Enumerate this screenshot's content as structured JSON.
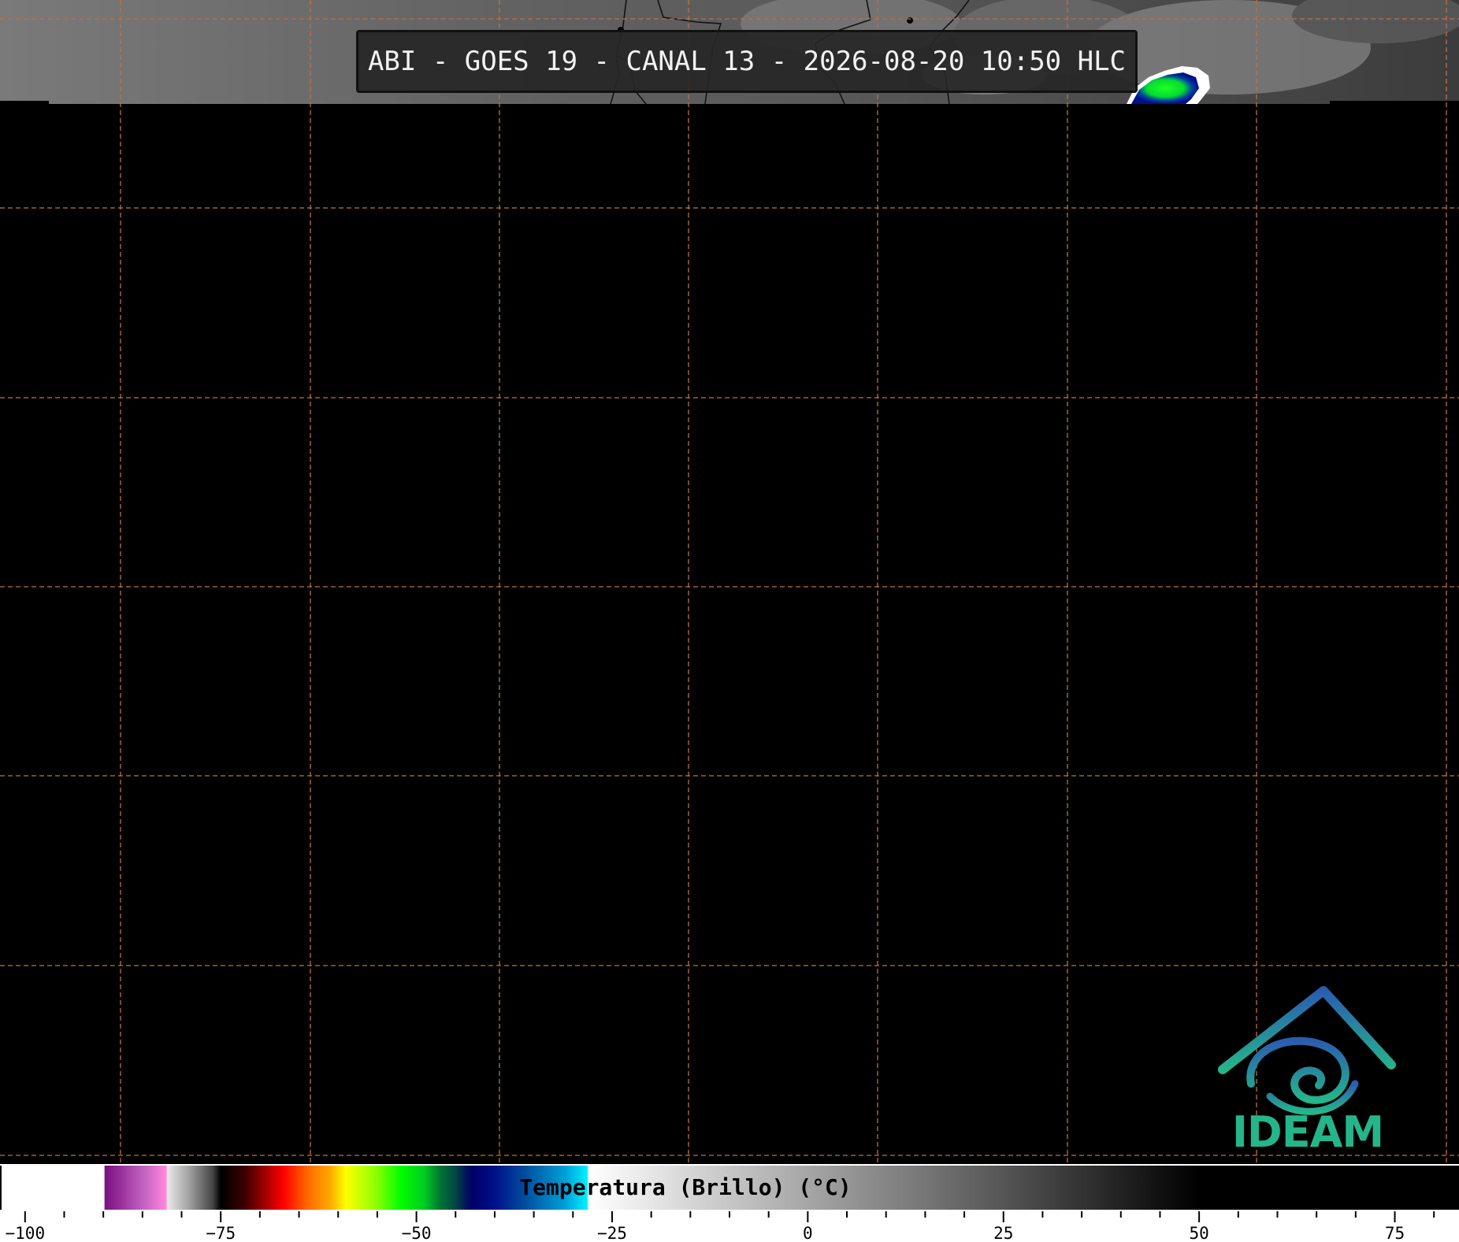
{
  "header": {
    "title": "ABI - GOES 19 - CANAL 13 - 2026-08-20 10:50 HLC"
  },
  "colorbar": {
    "label": "Temperatura (Brillo) (°C)",
    "range": [
      -103,
      83
    ],
    "ticks": [
      {
        "value": -100,
        "label": "−100"
      },
      {
        "value": -75,
        "label": "−75"
      },
      {
        "value": -50,
        "label": "−50"
      },
      {
        "value": -25,
        "label": "−25"
      },
      {
        "value": 0,
        "label": "0"
      },
      {
        "value": 25,
        "label": "25"
      },
      {
        "value": 50,
        "label": "50"
      },
      {
        "value": 75,
        "label": "75"
      }
    ],
    "minor_tick_step": 5,
    "stops": [
      {
        "value": -103,
        "color": "#ffffff"
      },
      {
        "value": -89.9,
        "color": "#ffffff"
      },
      {
        "value": -89.8,
        "color": "#7a0f80"
      },
      {
        "value": -85,
        "color": "#c060c0"
      },
      {
        "value": -82,
        "color": "#ff88dd"
      },
      {
        "value": -81.8,
        "color": "#e8e8e8"
      },
      {
        "value": -79,
        "color": "#a0a0a0"
      },
      {
        "value": -76,
        "color": "#444444"
      },
      {
        "value": -75,
        "color": "#000000"
      },
      {
        "value": -72,
        "color": "#3a0000"
      },
      {
        "value": -69,
        "color": "#b00000"
      },
      {
        "value": -67,
        "color": "#ff0000"
      },
      {
        "value": -64,
        "color": "#ff6600"
      },
      {
        "value": -61,
        "color": "#ffaa00"
      },
      {
        "value": -59,
        "color": "#ffff00"
      },
      {
        "value": -55,
        "color": "#88ff00"
      },
      {
        "value": -52,
        "color": "#00ff00"
      },
      {
        "value": -49,
        "color": "#00cc22"
      },
      {
        "value": -47,
        "color": "#007733"
      },
      {
        "value": -45,
        "color": "#004444"
      },
      {
        "value": -43,
        "color": "#000066"
      },
      {
        "value": -40,
        "color": "#00108a"
      },
      {
        "value": -36,
        "color": "#0050a0"
      },
      {
        "value": -31,
        "color": "#00a0d8"
      },
      {
        "value": -28.2,
        "color": "#00f0ff"
      },
      {
        "value": -28,
        "color": "#ffffff"
      },
      {
        "value": 0,
        "color": "#a6a6a6"
      },
      {
        "value": 25,
        "color": "#555555"
      },
      {
        "value": 50,
        "color": "#000000"
      },
      {
        "value": 83,
        "color": "#000000"
      }
    ]
  },
  "map": {
    "background_color": "#000000",
    "gridline_color": "#c07040",
    "satellite_strip_color": "#6e6e6e",
    "storm_cell_colors": [
      "#ffffff",
      "#00108a",
      "#00ff00"
    ]
  },
  "logo": {
    "text": "IDEAM",
    "colors": [
      "#2a5db0",
      "#25b58a"
    ]
  }
}
